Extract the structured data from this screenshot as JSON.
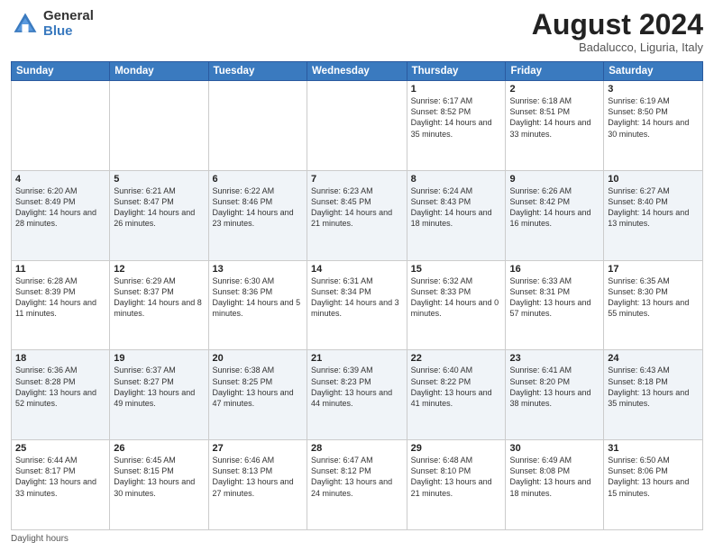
{
  "logo": {
    "general": "General",
    "blue": "Blue"
  },
  "title": "August 2024",
  "subtitle": "Badalucco, Liguria, Italy",
  "days": [
    "Sunday",
    "Monday",
    "Tuesday",
    "Wednesday",
    "Thursday",
    "Friday",
    "Saturday"
  ],
  "footer": "Daylight hours",
  "weeks": [
    [
      {
        "day": "",
        "info": ""
      },
      {
        "day": "",
        "info": ""
      },
      {
        "day": "",
        "info": ""
      },
      {
        "day": "",
        "info": ""
      },
      {
        "day": "1",
        "info": "Sunrise: 6:17 AM\nSunset: 8:52 PM\nDaylight: 14 hours and 35 minutes."
      },
      {
        "day": "2",
        "info": "Sunrise: 6:18 AM\nSunset: 8:51 PM\nDaylight: 14 hours and 33 minutes."
      },
      {
        "day": "3",
        "info": "Sunrise: 6:19 AM\nSunset: 8:50 PM\nDaylight: 14 hours and 30 minutes."
      }
    ],
    [
      {
        "day": "4",
        "info": "Sunrise: 6:20 AM\nSunset: 8:49 PM\nDaylight: 14 hours and 28 minutes."
      },
      {
        "day": "5",
        "info": "Sunrise: 6:21 AM\nSunset: 8:47 PM\nDaylight: 14 hours and 26 minutes."
      },
      {
        "day": "6",
        "info": "Sunrise: 6:22 AM\nSunset: 8:46 PM\nDaylight: 14 hours and 23 minutes."
      },
      {
        "day": "7",
        "info": "Sunrise: 6:23 AM\nSunset: 8:45 PM\nDaylight: 14 hours and 21 minutes."
      },
      {
        "day": "8",
        "info": "Sunrise: 6:24 AM\nSunset: 8:43 PM\nDaylight: 14 hours and 18 minutes."
      },
      {
        "day": "9",
        "info": "Sunrise: 6:26 AM\nSunset: 8:42 PM\nDaylight: 14 hours and 16 minutes."
      },
      {
        "day": "10",
        "info": "Sunrise: 6:27 AM\nSunset: 8:40 PM\nDaylight: 14 hours and 13 minutes."
      }
    ],
    [
      {
        "day": "11",
        "info": "Sunrise: 6:28 AM\nSunset: 8:39 PM\nDaylight: 14 hours and 11 minutes."
      },
      {
        "day": "12",
        "info": "Sunrise: 6:29 AM\nSunset: 8:37 PM\nDaylight: 14 hours and 8 minutes."
      },
      {
        "day": "13",
        "info": "Sunrise: 6:30 AM\nSunset: 8:36 PM\nDaylight: 14 hours and 5 minutes."
      },
      {
        "day": "14",
        "info": "Sunrise: 6:31 AM\nSunset: 8:34 PM\nDaylight: 14 hours and 3 minutes."
      },
      {
        "day": "15",
        "info": "Sunrise: 6:32 AM\nSunset: 8:33 PM\nDaylight: 14 hours and 0 minutes."
      },
      {
        "day": "16",
        "info": "Sunrise: 6:33 AM\nSunset: 8:31 PM\nDaylight: 13 hours and 57 minutes."
      },
      {
        "day": "17",
        "info": "Sunrise: 6:35 AM\nSunset: 8:30 PM\nDaylight: 13 hours and 55 minutes."
      }
    ],
    [
      {
        "day": "18",
        "info": "Sunrise: 6:36 AM\nSunset: 8:28 PM\nDaylight: 13 hours and 52 minutes."
      },
      {
        "day": "19",
        "info": "Sunrise: 6:37 AM\nSunset: 8:27 PM\nDaylight: 13 hours and 49 minutes."
      },
      {
        "day": "20",
        "info": "Sunrise: 6:38 AM\nSunset: 8:25 PM\nDaylight: 13 hours and 47 minutes."
      },
      {
        "day": "21",
        "info": "Sunrise: 6:39 AM\nSunset: 8:23 PM\nDaylight: 13 hours and 44 minutes."
      },
      {
        "day": "22",
        "info": "Sunrise: 6:40 AM\nSunset: 8:22 PM\nDaylight: 13 hours and 41 minutes."
      },
      {
        "day": "23",
        "info": "Sunrise: 6:41 AM\nSunset: 8:20 PM\nDaylight: 13 hours and 38 minutes."
      },
      {
        "day": "24",
        "info": "Sunrise: 6:43 AM\nSunset: 8:18 PM\nDaylight: 13 hours and 35 minutes."
      }
    ],
    [
      {
        "day": "25",
        "info": "Sunrise: 6:44 AM\nSunset: 8:17 PM\nDaylight: 13 hours and 33 minutes."
      },
      {
        "day": "26",
        "info": "Sunrise: 6:45 AM\nSunset: 8:15 PM\nDaylight: 13 hours and 30 minutes."
      },
      {
        "day": "27",
        "info": "Sunrise: 6:46 AM\nSunset: 8:13 PM\nDaylight: 13 hours and 27 minutes."
      },
      {
        "day": "28",
        "info": "Sunrise: 6:47 AM\nSunset: 8:12 PM\nDaylight: 13 hours and 24 minutes."
      },
      {
        "day": "29",
        "info": "Sunrise: 6:48 AM\nSunset: 8:10 PM\nDaylight: 13 hours and 21 minutes."
      },
      {
        "day": "30",
        "info": "Sunrise: 6:49 AM\nSunset: 8:08 PM\nDaylight: 13 hours and 18 minutes."
      },
      {
        "day": "31",
        "info": "Sunrise: 6:50 AM\nSunset: 8:06 PM\nDaylight: 13 hours and 15 minutes."
      }
    ]
  ]
}
